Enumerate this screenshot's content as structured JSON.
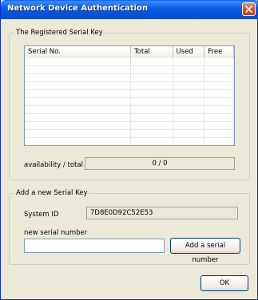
{
  "window": {
    "title": "Network Device Authentication"
  },
  "registered": {
    "group_label": "The Registered Serial Key",
    "columns": [
      "Serial No.",
      "Total",
      "Used",
      "Free"
    ],
    "rows": [],
    "availability_label": "availability / total",
    "availability_value": "0 / 0"
  },
  "add_key": {
    "group_label": "Add a new Serial Key",
    "system_id_label": "System ID",
    "system_id_value": "7D8E0D92C52E53",
    "new_serial_label": "new serial number",
    "new_serial_value": "",
    "add_button_label": "Add a serial number"
  },
  "ok_button_label": "OK",
  "icons": {
    "close": "close-icon"
  }
}
